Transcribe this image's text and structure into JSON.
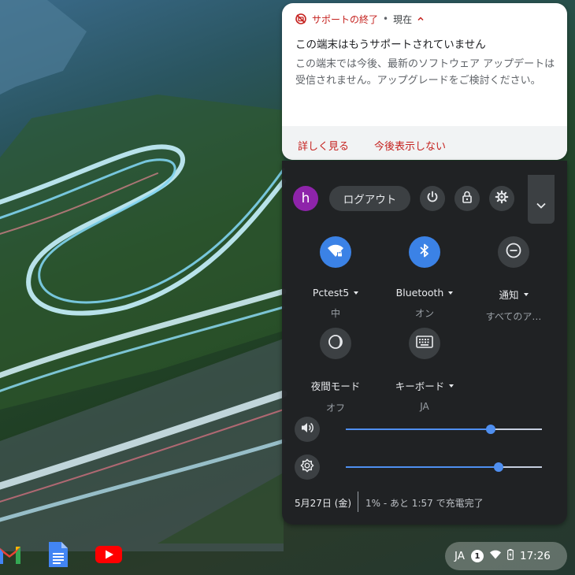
{
  "notification": {
    "app_name": "サポートの終了",
    "separator": "•",
    "time": "現在",
    "title": "この端末はもうサポートされていません",
    "body": "この端末では今後、最新のソフトウェア アップデートは受信されません。アップグレードをご検討ください。",
    "action_learn_more": "詳しく見る",
    "action_dont_show": "今後表示しない",
    "accent_color": "#c5221f"
  },
  "tray": {
    "avatar_letter": "h",
    "logout_label": "ログアウト",
    "power_icon": "power-icon",
    "lock_icon": "lock-icon",
    "settings_icon": "gear-icon",
    "collapse_icon": "chevron-down-icon",
    "tiles": [
      {
        "id": "wifi",
        "icon": "wifi-locked-icon",
        "label": "Pctest5",
        "sub": "中",
        "active": true
      },
      {
        "id": "bluetooth",
        "icon": "bluetooth-icon",
        "label": "Bluetooth",
        "sub": "オン",
        "active": true
      },
      {
        "id": "notifications",
        "icon": "do-not-disturb-icon",
        "label": "通知",
        "sub": "すべてのア…",
        "active": false
      },
      {
        "id": "night-light",
        "icon": "night-light-icon",
        "label": "夜間モード",
        "sub": "オフ",
        "active": false
      },
      {
        "id": "keyboard",
        "icon": "keyboard-icon",
        "label": "キーボード",
        "sub": "JA",
        "active": false
      }
    ],
    "volume": {
      "icon": "volume-icon",
      "level": 0.74
    },
    "brightness": {
      "icon": "brightness-icon",
      "level": 0.78
    },
    "date": "5月27日 (金)",
    "battery_status": "1% - あと 1:57 で充電完了",
    "accent_color": "#4f8ff0"
  },
  "shelf": {
    "apps": [
      {
        "name": "Gmail",
        "icon": "gmail-icon"
      },
      {
        "name": "Google Docs",
        "icon": "docs-icon"
      },
      {
        "name": "YouTube",
        "icon": "youtube-icon"
      }
    ],
    "ime": "JA",
    "notification_count": "1",
    "clock": "17:26"
  }
}
